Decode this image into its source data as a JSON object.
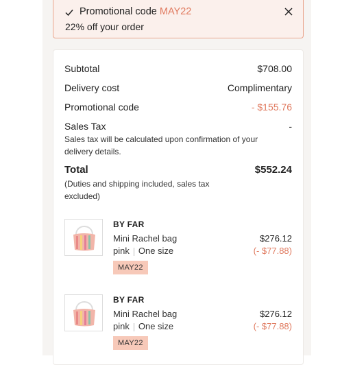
{
  "promo_banner": {
    "title_prefix": "Promotional code",
    "code": "MAY22",
    "description": "22% off your order",
    "check_icon": "check-icon",
    "close_icon": "close-icon"
  },
  "summary": {
    "subtotal": {
      "label": "Subtotal",
      "value": "$708.00"
    },
    "delivery": {
      "label": "Delivery cost",
      "value": "Complimentary"
    },
    "promo": {
      "label": "Promotional code",
      "value": "- $155.76"
    },
    "sales_tax": {
      "label": "Sales Tax",
      "value": "-",
      "note": "Sales tax will be calculated upon confirmation of your delivery details."
    },
    "total": {
      "label": "Total",
      "value": "$552.24",
      "note": "(Duties and shipping included, sales tax excluded)"
    }
  },
  "items": [
    {
      "brand": "BY FAR",
      "name": "Mini Rachel bag",
      "color": "pink",
      "size": "One size",
      "price": "$276.12",
      "discount": "(- $77.88)",
      "tag": "MAY22"
    },
    {
      "brand": "BY FAR",
      "name": "Mini Rachel bag",
      "color": "pink",
      "size": "One size",
      "price": "$276.12",
      "discount": "(- $77.88)",
      "tag": "MAY22"
    }
  ],
  "colors": {
    "accent": "#e07a5f",
    "tag_bg": "#f7c9b9",
    "banner_bg": "#fbf0ec",
    "banner_border": "#e9a58c"
  }
}
